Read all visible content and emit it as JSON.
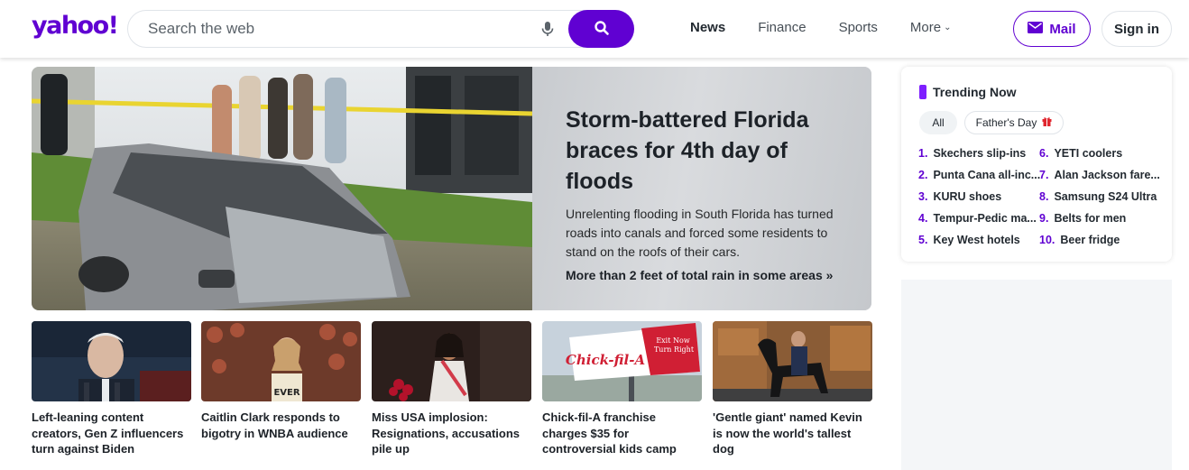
{
  "header": {
    "logo": "yahoo!",
    "search_placeholder": "Search the web",
    "nav": [
      {
        "label": "News",
        "active": true
      },
      {
        "label": "Finance",
        "active": false
      },
      {
        "label": "Sports",
        "active": false
      },
      {
        "label": "More",
        "active": false
      }
    ],
    "mail_label": "Mail",
    "signin_label": "Sign in",
    "icons": [
      "mic-icon",
      "search-icon",
      "mail-icon",
      "chevron-down-icon"
    ]
  },
  "hero": {
    "title": "Storm-battered Florida braces for 4th day of floods",
    "description": "Unrelenting flooding in South Florida has turned roads into canals and forced some residents to stand on the roofs of their cars.",
    "link": "More than 2 feet of total rain in some areas »"
  },
  "cards": [
    {
      "title": "Left-leaning content creators, Gen Z influencers turn against Biden"
    },
    {
      "title": "Caitlin Clark responds to bigotry in WNBA audience"
    },
    {
      "title": "Miss USA implosion: Resignations, accusations pile up"
    },
    {
      "title": "Chick-fil-A franchise charges $35 for controversial kids camp"
    },
    {
      "title": "'Gentle giant' named Kevin is now the world's tallest dog"
    }
  ],
  "billboard": {
    "brand": "Chick-fil-A",
    "tagline_1": "Exit Now",
    "tagline_2": "Turn Right"
  },
  "jersey_text": "EVER",
  "trending": {
    "title": "Trending Now",
    "pills": [
      "All",
      "Father's Day"
    ],
    "left": [
      {
        "num": "1.",
        "label": "Skechers slip-ins"
      },
      {
        "num": "2.",
        "label": "Punta Cana all-inc..."
      },
      {
        "num": "3.",
        "label": "KURU shoes"
      },
      {
        "num": "4.",
        "label": "Tempur-Pedic ma..."
      },
      {
        "num": "5.",
        "label": "Key West hotels"
      }
    ],
    "right": [
      {
        "num": "6.",
        "label": "YETI coolers"
      },
      {
        "num": "7.",
        "label": "Alan Jackson fare..."
      },
      {
        "num": "8.",
        "label": "Samsung S24 Ultra"
      },
      {
        "num": "9.",
        "label": "Belts for men"
      },
      {
        "num": "10.",
        "label": "Beer fridge"
      }
    ]
  },
  "colors": {
    "brand": "#6001d2",
    "accent": "#7e1fff",
    "text": "#232a31"
  }
}
